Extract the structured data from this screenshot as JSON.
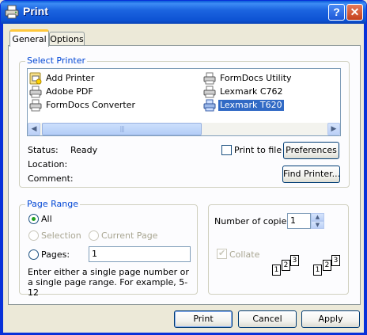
{
  "window": {
    "title": "Print",
    "help_glyph": "?",
    "close_glyph": "✕"
  },
  "tabs": [
    {
      "label": "General",
      "active": true
    },
    {
      "label": "Options",
      "active": false
    }
  ],
  "select_printer": {
    "legend": "Select Printer",
    "printers": [
      {
        "name": "Add Printer",
        "icon": "add-printer-icon",
        "selected": false
      },
      {
        "name": "Adobe PDF",
        "icon": "printer-icon",
        "selected": false
      },
      {
        "name": "FormDocs Converter",
        "icon": "printer-icon",
        "selected": false
      },
      {
        "name": "FormDocs Utility",
        "icon": "printer-icon",
        "selected": false
      },
      {
        "name": "Lexmark C762",
        "icon": "printer-icon",
        "selected": false
      },
      {
        "name": "Lexmark T620",
        "icon": "printer-icon",
        "selected": true
      }
    ],
    "scroll_left": "◀",
    "scroll_right": "▶",
    "thumb_grip": "|||",
    "status_label": "Status:",
    "status_value": "Ready",
    "location_label": "Location:",
    "location_value": "",
    "comment_label": "Comment:",
    "comment_value": "",
    "print_to_file_label": "Print to file",
    "preferences_label": "Preferences",
    "find_printer_label": "Find Printer..."
  },
  "page_range": {
    "legend": "Page Range",
    "all_label": "All",
    "selection_label": "Selection",
    "current_page_label": "Current Page",
    "pages_label": "Pages:",
    "pages_value": "1",
    "hint": "Enter either a single page number or a single page range.  For example, 5-12"
  },
  "copies": {
    "label": "Number of copies:",
    "value": "1",
    "collate_label": "Collate",
    "spin_up": "▲",
    "spin_down": "▼",
    "page_numbers": [
      "1",
      "2",
      "3"
    ]
  },
  "buttons": {
    "print": "Print",
    "cancel": "Cancel",
    "apply": "Apply"
  },
  "colors": {
    "titlebar": "#0a5bd8",
    "group_legend": "#0046d5",
    "selection": "#316ac5",
    "tab_highlight": "#ffc83c"
  }
}
